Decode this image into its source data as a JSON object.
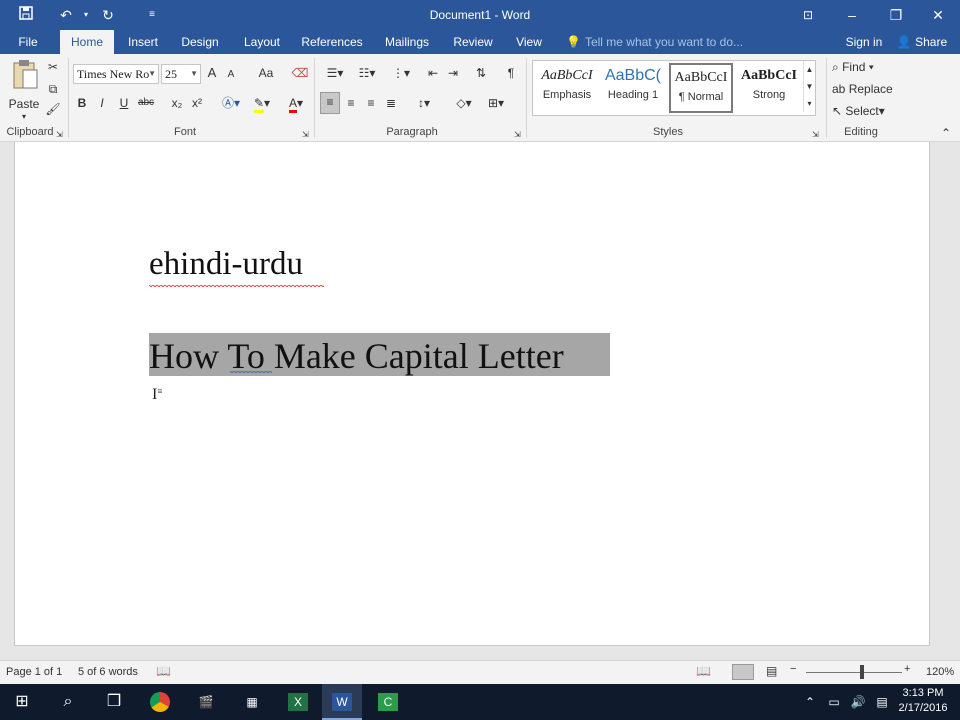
{
  "window": {
    "title": "Document1 - Word"
  },
  "quick_access": {
    "save_icon": "save-icon",
    "undo_icon": "undo-icon",
    "redo_icon": "repeat-icon",
    "customize_icon": "customize-icon"
  },
  "window_controls": {
    "ribbon_display": "ribbon-display-icon",
    "minimize": "–",
    "restore": "❐",
    "close": "✕"
  },
  "tabs": [
    "File",
    "Home",
    "Insert",
    "Design",
    "Layout",
    "References",
    "Mailings",
    "Review",
    "View"
  ],
  "active_tab": "Home",
  "tell_me": {
    "placeholder": "Tell me what you want to do..."
  },
  "account": {
    "sign_in": "Sign in",
    "share": "Share"
  },
  "clipboard": {
    "paste": "Paste",
    "group": "Clipboard"
  },
  "font": {
    "name": "Times New Ro",
    "size": "25",
    "group": "Font",
    "buttons": {
      "bold": "B",
      "italic": "I",
      "underline": "U",
      "strike": "abc",
      "sub": "x₂",
      "sup": "x²",
      "grow": "A",
      "shrink": "A",
      "case": "Aa"
    }
  },
  "paragraph": {
    "group": "Paragraph",
    "pilcrow": "¶"
  },
  "styles": {
    "group": "Styles",
    "items": [
      {
        "preview": "AaBbCcI",
        "name": "Emphasis"
      },
      {
        "preview": "AaBbC(",
        "name": "Heading 1"
      },
      {
        "preview": "AaBbCcI",
        "name": "¶ Normal"
      },
      {
        "preview": "AaBbCcI",
        "name": "Strong"
      }
    ]
  },
  "editing": {
    "group": "Editing",
    "find": "Find",
    "replace": "Replace",
    "select": "Select"
  },
  "document": {
    "line1": "ehindi-urdu",
    "line2": "How To Make Capital Letter"
  },
  "status": {
    "page": "Page 1 of 1",
    "words": "5 of 6 words",
    "zoom": "120%",
    "zoom_level": 1.2
  },
  "taskbar": {
    "time": "3:13 PM",
    "date": "2/17/2016"
  },
  "colors": {
    "accent": "#2b579a",
    "highlight": "#ffff00",
    "font_color": "#ff0000",
    "selection": "#a6a6a6"
  }
}
